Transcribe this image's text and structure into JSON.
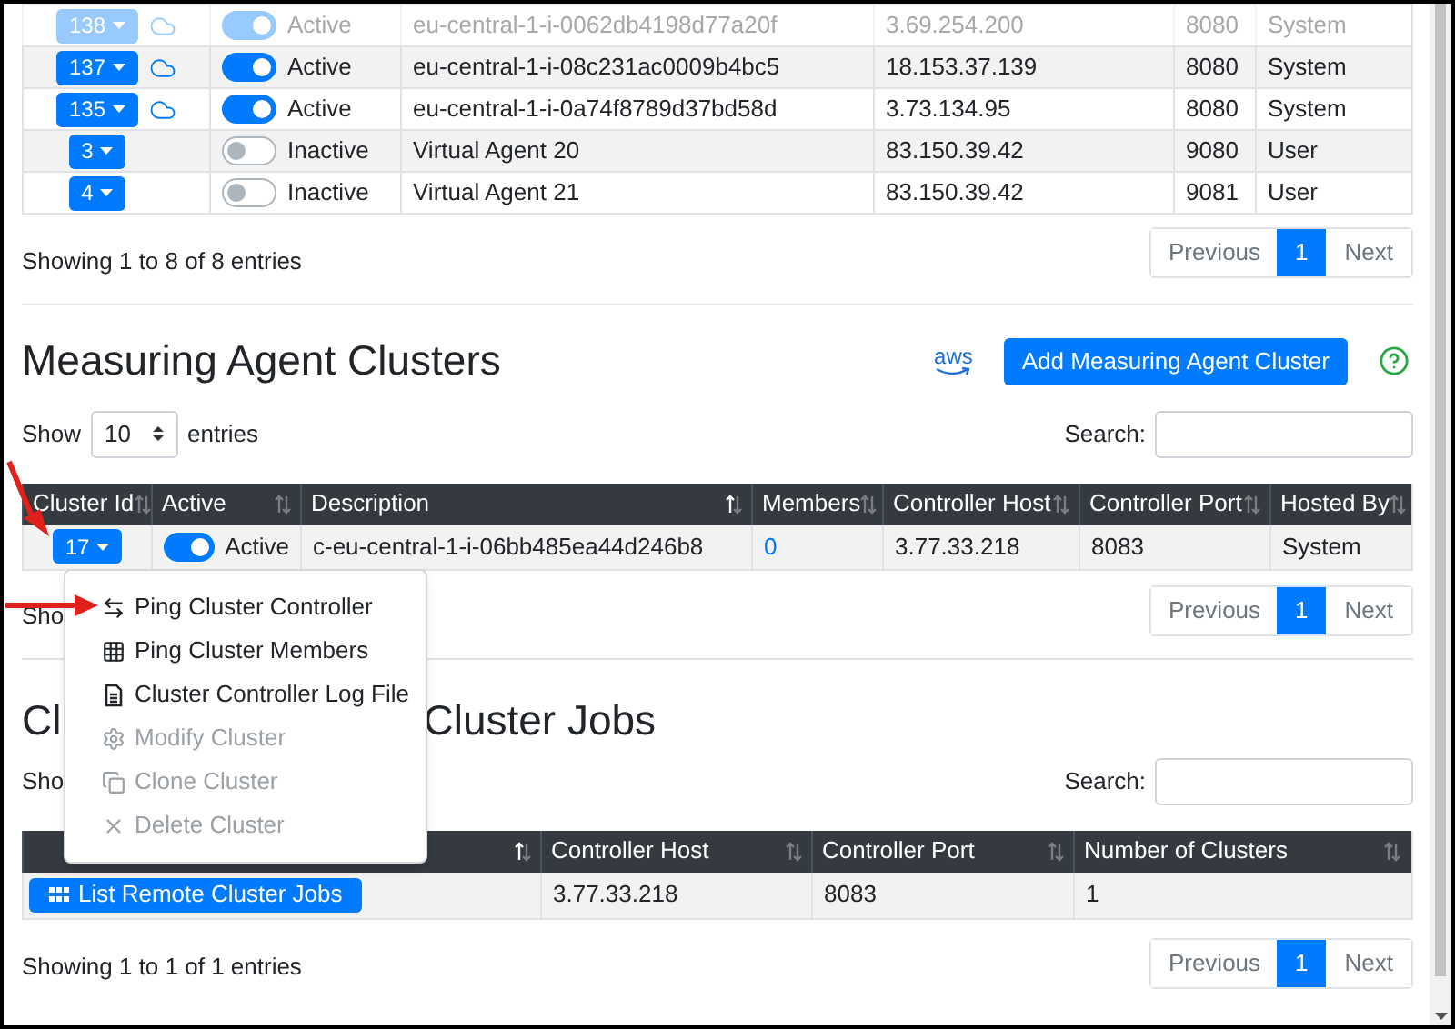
{
  "agents_table": {
    "rows": [
      {
        "id": "138",
        "cloud": true,
        "on": true,
        "status": "Active",
        "description": "eu-central-1-i-0062db4198d77a20f",
        "host": "3.69.254.200",
        "port": "8080",
        "hosted_by": "System",
        "faded": true
      },
      {
        "id": "137",
        "cloud": true,
        "on": true,
        "status": "Active",
        "description": "eu-central-1-i-08c231ac0009b4bc5",
        "host": "18.153.37.139",
        "port": "8080",
        "hosted_by": "System",
        "faded": false
      },
      {
        "id": "135",
        "cloud": true,
        "on": true,
        "status": "Active",
        "description": "eu-central-1-i-0a74f8789d37bd58d",
        "host": "3.73.134.95",
        "port": "8080",
        "hosted_by": "System",
        "faded": false
      },
      {
        "id": "3",
        "cloud": false,
        "on": false,
        "status": "Inactive",
        "description": "Virtual Agent 20",
        "host": "83.150.39.42",
        "port": "9080",
        "hosted_by": "User",
        "faded": false
      },
      {
        "id": "4",
        "cloud": false,
        "on": false,
        "status": "Inactive",
        "description": "Virtual Agent 21",
        "host": "83.150.39.42",
        "port": "9081",
        "hosted_by": "User",
        "faded": false
      }
    ],
    "info": "Showing 1 to 8 of 8 entries",
    "pagination": {
      "previous": "Previous",
      "pages": [
        {
          "label": "1",
          "selected": true
        }
      ],
      "next": "Next"
    }
  },
  "clusters": {
    "title": "Measuring Agent Clusters",
    "aws_logo": "aws",
    "add_button": "Add Measuring Agent Cluster",
    "length": {
      "show": "Show",
      "value": "10",
      "entries": "entries"
    },
    "search_label": "Search:",
    "columns": [
      {
        "label": "Cluster Id",
        "sorted": false
      },
      {
        "label": "Active",
        "sorted": false
      },
      {
        "label": "Description",
        "sorted": true
      },
      {
        "label": "Members",
        "sorted": false
      },
      {
        "label": "Controller Host",
        "sorted": false
      },
      {
        "label": "Controller Port",
        "sorted": false
      },
      {
        "label": "Hosted By",
        "sorted": false
      }
    ],
    "rows": [
      {
        "id": "17",
        "on": true,
        "status": "Active",
        "description": "c-eu-central-1-i-06bb485ea44d246b8",
        "members": "0",
        "host": "3.77.33.218",
        "port": "8083",
        "hosted_by": "System"
      }
    ],
    "info": "Sho",
    "pagination": {
      "previous": "Previous",
      "pages": [
        {
          "label": "1",
          "selected": true
        }
      ],
      "next": "Next"
    }
  },
  "dropdown_menu": {
    "items": [
      {
        "label": "Ping Cluster Controller",
        "disabled": false
      },
      {
        "label": "Ping Cluster Members",
        "disabled": false
      },
      {
        "label": "Cluster Controller Log File",
        "disabled": false
      },
      {
        "label": "Modify Cluster",
        "disabled": true
      },
      {
        "label": "Clone Cluster",
        "disabled": true
      },
      {
        "label": "Delete Cluster",
        "disabled": true
      }
    ]
  },
  "jobs": {
    "title_start": "Cl",
    "title_end": "Cluster Jobs",
    "show": "Sho",
    "search_label": "Search:",
    "columns": [
      {
        "sorted": true
      },
      {
        "label": "Controller Host",
        "sorted": false
      },
      {
        "label": "Controller Port",
        "sorted": false
      },
      {
        "label": "Number of Clusters",
        "sorted": false
      }
    ],
    "rows": [
      {
        "button": "List Remote Cluster Jobs",
        "host": "3.77.33.218",
        "port": "8083",
        "count": "1"
      }
    ],
    "info": "Showing 1 to 1 of 1 entries",
    "pagination": {
      "previous": "Previous",
      "pages": [
        {
          "label": "1",
          "selected": true
        }
      ],
      "next": "Next"
    }
  }
}
